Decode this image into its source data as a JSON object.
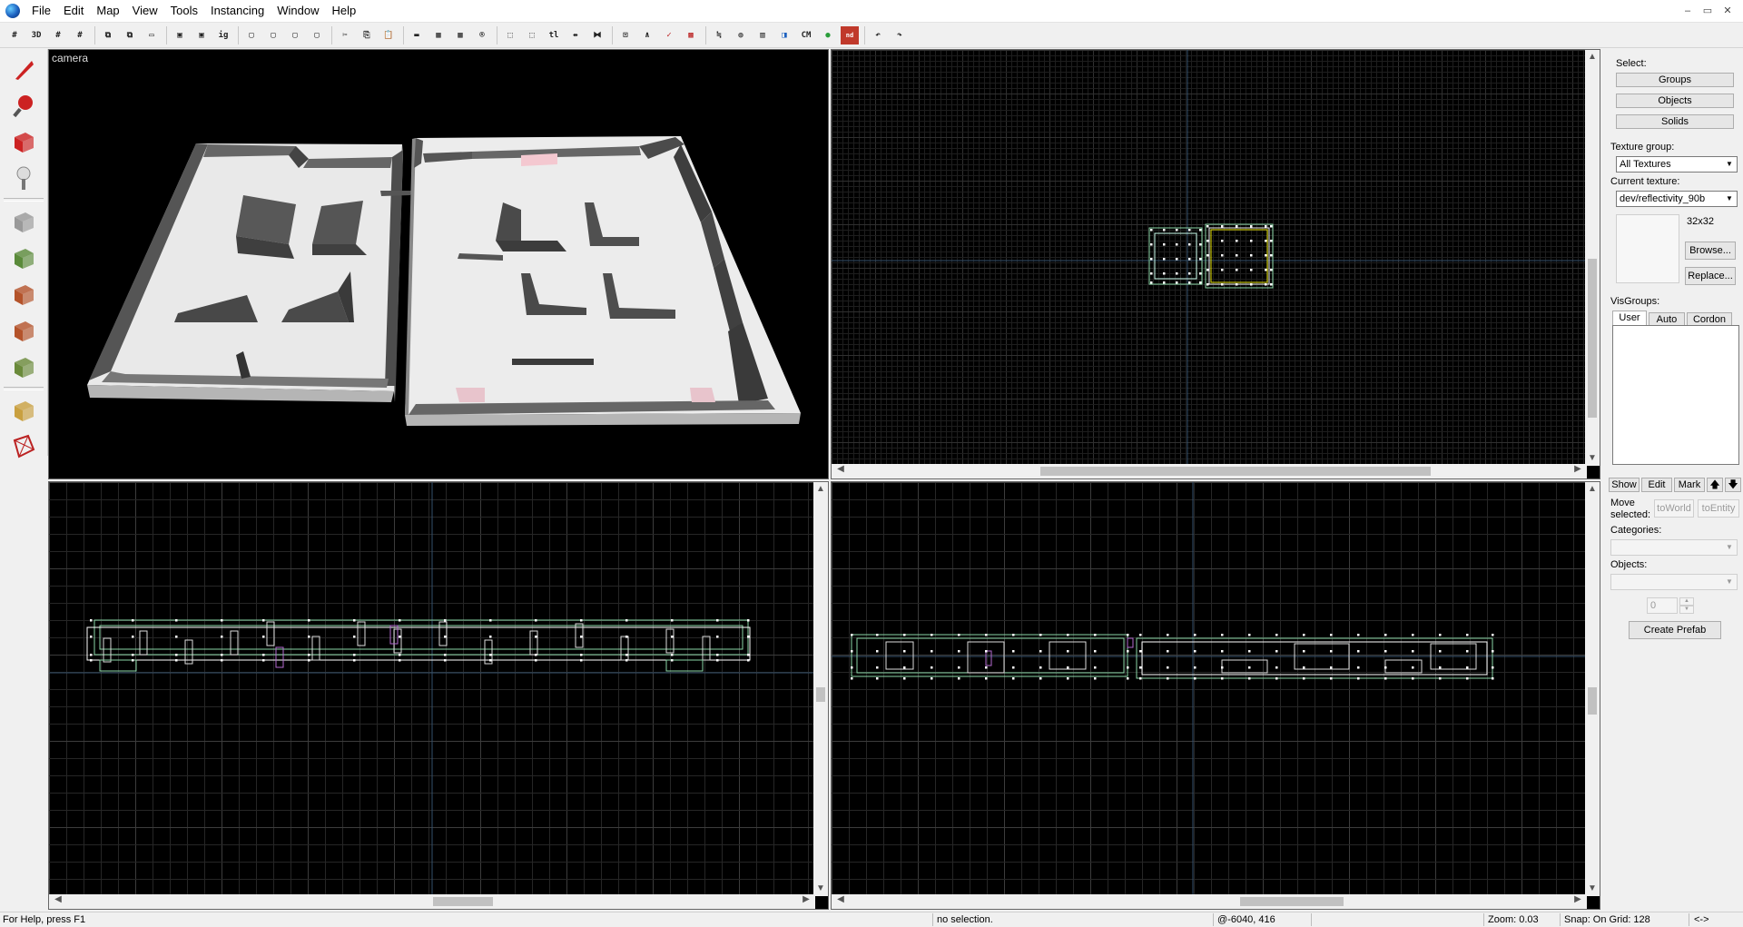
{
  "menu": [
    "File",
    "Edit",
    "Map",
    "View",
    "Tools",
    "Instancing",
    "Window",
    "Help"
  ],
  "window_controls": [
    "–",
    "▭",
    "✕"
  ],
  "toolbar": {
    "buttons": [
      {
        "icon": "grid-icon",
        "glyph": "#"
      },
      {
        "icon": "3d-grid-icon",
        "glyph": "3D"
      },
      {
        "icon": "grid-smaller-icon",
        "glyph": "#"
      },
      {
        "icon": "grid-larger-icon",
        "glyph": "#"
      },
      {
        "icon": "carve-icon",
        "glyph": "⧉"
      },
      {
        "icon": "group-icon",
        "glyph": "⧉"
      },
      {
        "icon": "hide-icon",
        "glyph": "▭"
      },
      {
        "icon": "select-icon",
        "glyph": "▣"
      },
      {
        "icon": "select-2-icon",
        "glyph": "▣"
      },
      {
        "icon": "ignore-groups-icon",
        "glyph": "ig"
      },
      {
        "icon": "solid-icon",
        "glyph": "▢"
      },
      {
        "icon": "solid-2-icon",
        "glyph": "▢"
      },
      {
        "icon": "solid-3-icon",
        "glyph": "▢"
      },
      {
        "icon": "solid-4-icon",
        "glyph": "▢"
      },
      {
        "icon": "cut-icon",
        "glyph": "✂"
      },
      {
        "icon": "copy-icon",
        "glyph": "⎘"
      },
      {
        "icon": "paste-icon",
        "glyph": "📋"
      },
      {
        "icon": "texture-lock-icon",
        "glyph": "▬"
      },
      {
        "icon": "texture-icon",
        "glyph": "▦"
      },
      {
        "icon": "texture-2-icon",
        "glyph": "▦"
      },
      {
        "icon": "radius-icon",
        "glyph": "®"
      },
      {
        "icon": "bbox-icon",
        "glyph": "⬚"
      },
      {
        "icon": "select-tool-icon",
        "glyph": "⬚"
      },
      {
        "icon": "tl-icon",
        "glyph": "tl"
      },
      {
        "icon": "flip-icon",
        "glyph": "⇹"
      },
      {
        "icon": "hollow-icon",
        "glyph": "⧓"
      },
      {
        "icon": "model-icon",
        "glyph": "⊡"
      },
      {
        "icon": "angle-icon",
        "glyph": "∧"
      },
      {
        "icon": "vertex-icon",
        "glyph": "✓"
      },
      {
        "icon": "overlay-icon",
        "glyph": "▩"
      },
      {
        "icon": "align-icon",
        "glyph": "≒"
      },
      {
        "icon": "sphere-icon",
        "glyph": "◍"
      },
      {
        "icon": "wireframe-icon",
        "glyph": "▥"
      },
      {
        "icon": "blocks-icon",
        "glyph": "◨"
      },
      {
        "icon": "cm-icon",
        "glyph": "CM"
      },
      {
        "icon": "green-icon",
        "glyph": "●"
      },
      {
        "icon": "nodraw-icon",
        "glyph": "nd"
      },
      {
        "icon": "undo-icon",
        "glyph": "↶"
      },
      {
        "icon": "redo-icon",
        "glyph": "↷"
      }
    ]
  },
  "palette": [
    "selection-tool-icon",
    "magnify-tool-icon",
    "camera-tool-icon",
    "entity-tool-icon",
    "block-tool-icon",
    "texture-application-icon",
    "apply-texture-icon",
    "decal-tool-icon",
    "overlay-tool-icon",
    "clipping-tool-icon",
    "vertex-tool-icon"
  ],
  "viewports": {
    "camera_label": "camera"
  },
  "right_panel": {
    "select_label": "Select:",
    "groups_btn": "Groups",
    "objects_btn": "Objects",
    "solids_btn": "Solids",
    "texture_group_label": "Texture group:",
    "texture_group_value": "All Textures",
    "current_texture_label": "Current texture:",
    "current_texture_value": "dev/reflectivity_90b",
    "texture_size": "32x32",
    "browse_btn": "Browse...",
    "replace_btn": "Replace...",
    "visgroups_label": "VisGroups:",
    "vis_tabs": [
      "User",
      "Auto",
      "Cordon"
    ],
    "show_btn": "Show",
    "edit_btn": "Edit",
    "mark_btn": "Mark",
    "up_btn": "🡅",
    "down_btn": "🡇",
    "move_selected_label": "Move\nselected:",
    "to_world_btn": "toWorld",
    "to_entity_btn": "toEntity",
    "categories_label": "Categories:",
    "objects_label": "Objects:",
    "count_value": "0",
    "create_prefab_btn": "Create Prefab"
  },
  "status": {
    "help": "For Help, press F1",
    "selection": "no selection.",
    "coords": "@-6040, 416",
    "zoom": "Zoom: 0.03",
    "snap": "Snap: On Grid: 128",
    "arrows": "<->"
  },
  "colors": {
    "wire_green": "#8ad6a6",
    "wire_white": "#ffffff",
    "grid": "#3a3a3a",
    "grid_major": "#505050",
    "axis": "#2e4d6a"
  }
}
